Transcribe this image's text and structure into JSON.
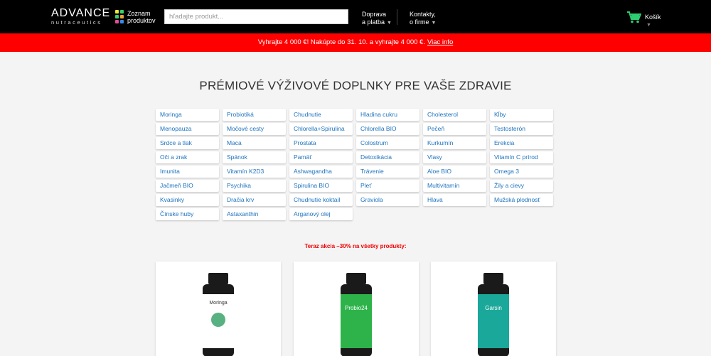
{
  "header": {
    "logo": {
      "main": "ADVANCE",
      "sub": "nutraceutics"
    },
    "catalog": {
      "label": "Zoznam produktov",
      "icon": "grid-colored-icon"
    },
    "search": {
      "placeholder": "hľadajte produkt..."
    },
    "nav": [
      {
        "label": "Doprava a platba",
        "line1": "Doprava",
        "line2": "a platba"
      },
      {
        "label": "Kontakty, o firme",
        "line1": "Kontakty,",
        "line2": "o firme"
      }
    ],
    "cart": {
      "label": "Košík",
      "icon": "shopping-cart-icon",
      "color": "#2ecc71"
    }
  },
  "promo": {
    "text": "Vyhrajte 4 000 €! Nakúpte do 31. 10. a vyhrajte 4 000 €.",
    "link": "Viac info",
    "color": "#ff0000"
  },
  "heading": "PRÉMIOVÉ VÝŽIVOVÉ DOPLNKY PRE VAŠE ZDRAVIE",
  "categories": [
    "Moringa",
    "Probiotiká",
    "Chudnutie",
    "Hladina cukru",
    "Cholesterol",
    "Kĺby",
    "Menopauza",
    "Močové cesty",
    "Chlorella+Spirulina",
    "Chlorella BIO",
    "Pečeň",
    "Testosterón",
    "Srdce a tlak",
    "Maca",
    "Prostata",
    "Colostrum",
    "Kurkumín",
    "Erekcia",
    "Oči a zrak",
    "Spánok",
    "Pamäť",
    "Detoxikácia",
    "Vlasy",
    "Vitamín C prírod",
    "Imunita",
    "Vitamín K2D3",
    "Ashwagandha",
    "Trávenie",
    "Aloe BIO",
    "Omega 3",
    "Jačmeň BIO",
    "Psychika",
    "Spirulina BIO",
    "Pleť",
    "Multivitamín",
    "Žily a cievy",
    "Kvasinky",
    "Dračia krv",
    "Chudnutie koktail",
    "Graviola",
    "Hlava",
    "Mužská plodnosť",
    "Čínske huby",
    "Astaxanthin",
    "Arganový olej"
  ],
  "action_text": "Teraz akcia –30% na všetky produkty:",
  "products": [
    {
      "name": "Moringa",
      "label_color": "#ffffff",
      "label_text_color": "#333333"
    },
    {
      "name": "Probio24",
      "label_color": "#2db34a",
      "label_text_color": "#ffffff"
    },
    {
      "name": "Garsin",
      "label_color": "#1aa89a",
      "label_text_color": "#ffffff"
    }
  ]
}
